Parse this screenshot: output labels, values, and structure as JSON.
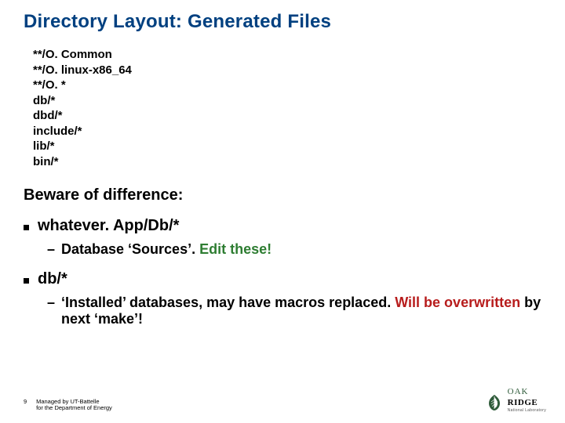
{
  "title": "Directory Layout: Generated Files",
  "paths": {
    "p0": "**/O. Common",
    "p1": "**/O. linux-x86_64",
    "p2": "**/O. *",
    "p3": "db/*",
    "p4": "dbd/*",
    "p5": "include/*",
    "p6": "lib/*",
    "p7": "bin/*"
  },
  "heading2": "Beware of difference:",
  "bullet_a": "whatever. App/Db/*",
  "sub_a_pre": "Database ‘Sources’. ",
  "sub_a_green": "Edit these!",
  "bullet_b": "db/*",
  "sub_b_pre": "‘Installed’ databases, may have macros replaced. ",
  "sub_b_red": "Will be overwritten ",
  "sub_b_post": "by next ‘make’!",
  "footer": {
    "pagenum": "9",
    "line1": "Managed by UT-Battelle",
    "line2": "for the Department of Energy"
  },
  "logo": {
    "word1": "OAK",
    "word2": "RIDGE",
    "sub": "National Laboratory"
  }
}
